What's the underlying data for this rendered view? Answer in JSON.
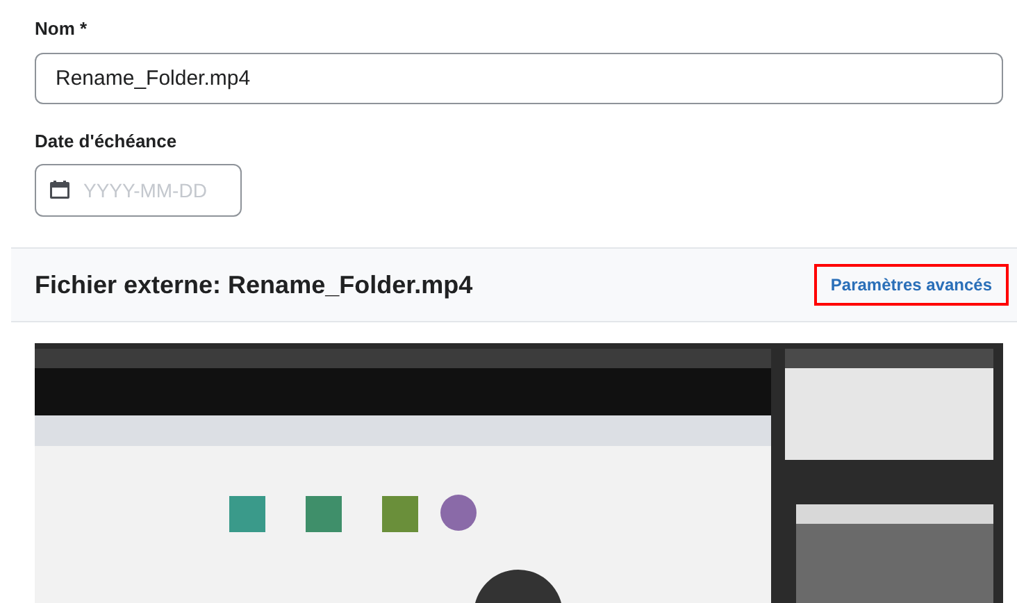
{
  "name_field": {
    "label": "Nom *",
    "value": "Rename_Folder.mp4"
  },
  "date_field": {
    "label": "Date d'échéance",
    "placeholder": "YYYY-MM-DD"
  },
  "file_section": {
    "title": "Fichier externe: Rename_Folder.mp4",
    "link": {
      "label": "Paramètres avancés",
      "highlighted": true
    }
  }
}
